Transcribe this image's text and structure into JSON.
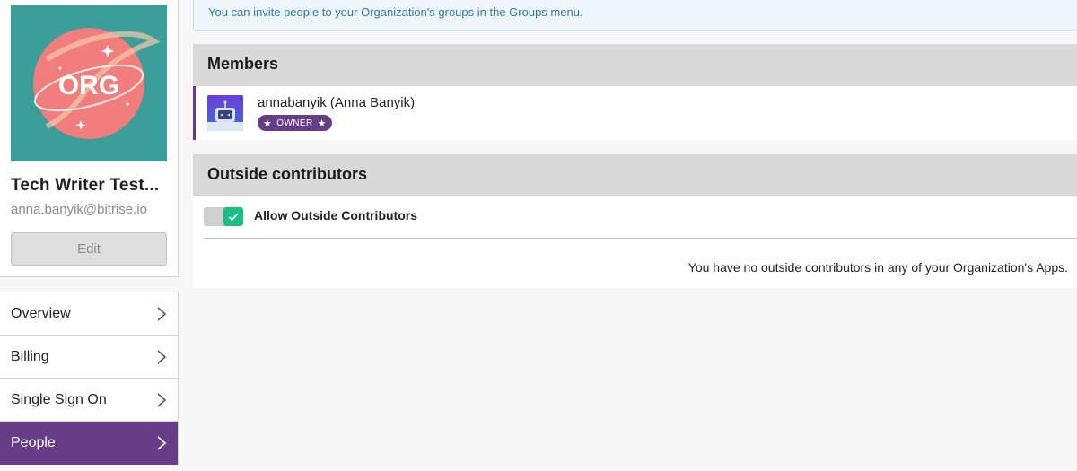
{
  "organization": {
    "title": "Tech Writer Test...",
    "email": "anna.banyik@bitrise.io",
    "edit_label": "Edit",
    "logo_text": "ORG"
  },
  "nav": {
    "items": [
      {
        "label": "Overview",
        "active": false
      },
      {
        "label": "Billing",
        "active": false
      },
      {
        "label": "Single Sign On",
        "active": false
      },
      {
        "label": "People",
        "active": true
      }
    ]
  },
  "info_bar": {
    "text": "You can invite people to your Organization's groups in the Groups menu."
  },
  "members": {
    "heading": "Members",
    "list": [
      {
        "name": "annabanyik (Anna Banyik)",
        "role": "OWNER"
      }
    ]
  },
  "outside_contributors": {
    "heading": "Outside contributors",
    "toggle_label": "Allow Outside Contributors",
    "toggle_on": true,
    "empty_text": "You have no outside contributors in any of your Organization's Apps."
  },
  "colors": {
    "accent_purple": "#683d87",
    "toggle_green": "#1bbf83",
    "info_blue": "#2e7aa5",
    "avatar_teal": "#3b9e9b"
  }
}
